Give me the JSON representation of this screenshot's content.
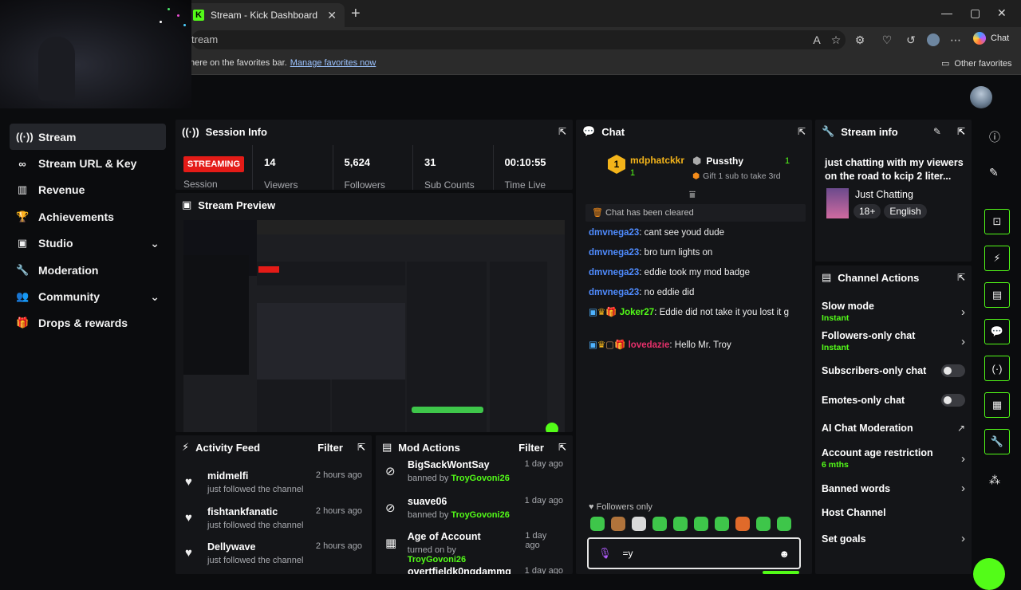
{
  "browser": {
    "tab_title": "Stream - Kick Dashboard",
    "url": "tream",
    "chat_button": "Chat",
    "favorites_text": "here on the favorites bar.",
    "favorites_link": "Manage favorites now",
    "other_favorites": "Other favorites"
  },
  "sidebar": {
    "items": [
      {
        "label": "Stream",
        "icon": "broadcast-icon"
      },
      {
        "label": "Stream URL & Key",
        "icon": "link-icon"
      },
      {
        "label": "Revenue",
        "icon": "bar-chart-icon"
      },
      {
        "label": "Achievements",
        "icon": "trophy-icon"
      },
      {
        "label": "Studio",
        "icon": "studio-icon"
      },
      {
        "label": "Moderation",
        "icon": "wrench-icon"
      },
      {
        "label": "Community",
        "icon": "users-icon"
      },
      {
        "label": "Drops & rewards",
        "icon": "gift-icon"
      }
    ]
  },
  "session": {
    "title": "Session Info",
    "status": "STREAMING",
    "status_label": "Session",
    "stats": [
      {
        "value": "14",
        "label": "Viewers"
      },
      {
        "value": "5,624",
        "label": "Followers"
      },
      {
        "value": "31",
        "label": "Sub Counts"
      },
      {
        "value": "00:10:55",
        "label": "Time Live"
      }
    ]
  },
  "preview": {
    "title": "Stream Preview"
  },
  "activity": {
    "title": "Activity Feed",
    "filter": "Filter",
    "items": [
      {
        "name": "midmelfi",
        "sub": "just followed the channel",
        "time": "2 hours ago"
      },
      {
        "name": "fishtankfanatic",
        "sub": "just followed the channel",
        "time": "2 hours ago"
      },
      {
        "name": "Dellywave",
        "sub": "just followed the channel",
        "time": "2 hours ago"
      }
    ]
  },
  "mod": {
    "title": "Mod Actions",
    "filter": "Filter",
    "items": [
      {
        "name": "BigSackWontSay",
        "action": "banned by",
        "by": "TroyGovoni26",
        "time": "1 day ago"
      },
      {
        "name": "suave06",
        "action": "banned by",
        "by": "TroyGovoni26",
        "time": "1 day ago"
      },
      {
        "name": "Age of Account",
        "action": "turned on by",
        "by": "TroyGovoni26",
        "time": "1 day ago"
      },
      {
        "name": "overtfieldk0nqdammg",
        "action": "",
        "by": "",
        "time": "1 day ago"
      }
    ]
  },
  "chat": {
    "title": "Chat",
    "leaders": [
      {
        "rank": "1",
        "name": "mdphatckkr",
        "count": "1"
      },
      {
        "rank": "",
        "name": "Pussthy",
        "count": "1",
        "sub": "Gift 1 sub to take 3rd"
      }
    ],
    "cleared": "Chat has been cleared",
    "messages": [
      {
        "user": "dmvnega23",
        "text": "cant see youd dude",
        "color": "#4f8cff"
      },
      {
        "user": "dmvnega23",
        "text": "bro turn lights on",
        "color": "#4f8cff"
      },
      {
        "user": "dmvnega23",
        "text": "eddie took my mod badge",
        "color": "#4f8cff"
      },
      {
        "user": "dmvnega23",
        "text": "no eddie did",
        "color": "#4f8cff"
      },
      {
        "user": "Joker27",
        "text": "Eddie did not take it you lost it g",
        "color": "#53fc18"
      },
      {
        "user": "lovedazie",
        "text": "Hello Mr. Troy",
        "color": "#e8306b"
      }
    ],
    "followers_only": "Followers only",
    "input_value": "=y"
  },
  "stream_info": {
    "title": "Stream info",
    "description": "just chatting with my viewers on the road to kcip 2 liter...",
    "category": "Just Chatting",
    "tags": [
      "18+",
      "English"
    ]
  },
  "channel_actions": {
    "title": "Channel Actions",
    "rows": [
      {
        "label": "Slow mode",
        "sub": "Instant",
        "control": "chevron"
      },
      {
        "label": "Followers-only chat",
        "sub": "Instant",
        "control": "chevron"
      },
      {
        "label": "Subscribers-only chat",
        "sub": "",
        "control": "toggle"
      },
      {
        "label": "Emotes-only chat",
        "sub": "",
        "control": "toggle"
      },
      {
        "label": "AI Chat Moderation",
        "sub": "",
        "control": "external"
      },
      {
        "label": "Account age restriction",
        "sub": "6 mths",
        "control": "chevron"
      },
      {
        "label": "Banned words",
        "sub": "",
        "control": "chevron"
      },
      {
        "label": "Host Channel",
        "sub": "",
        "control": "none"
      },
      {
        "label": "Set goals",
        "sub": "",
        "control": "chevron"
      }
    ]
  },
  "colors": {
    "accent": "#53fc18",
    "live": "#e41b17",
    "panel": "#141518"
  }
}
